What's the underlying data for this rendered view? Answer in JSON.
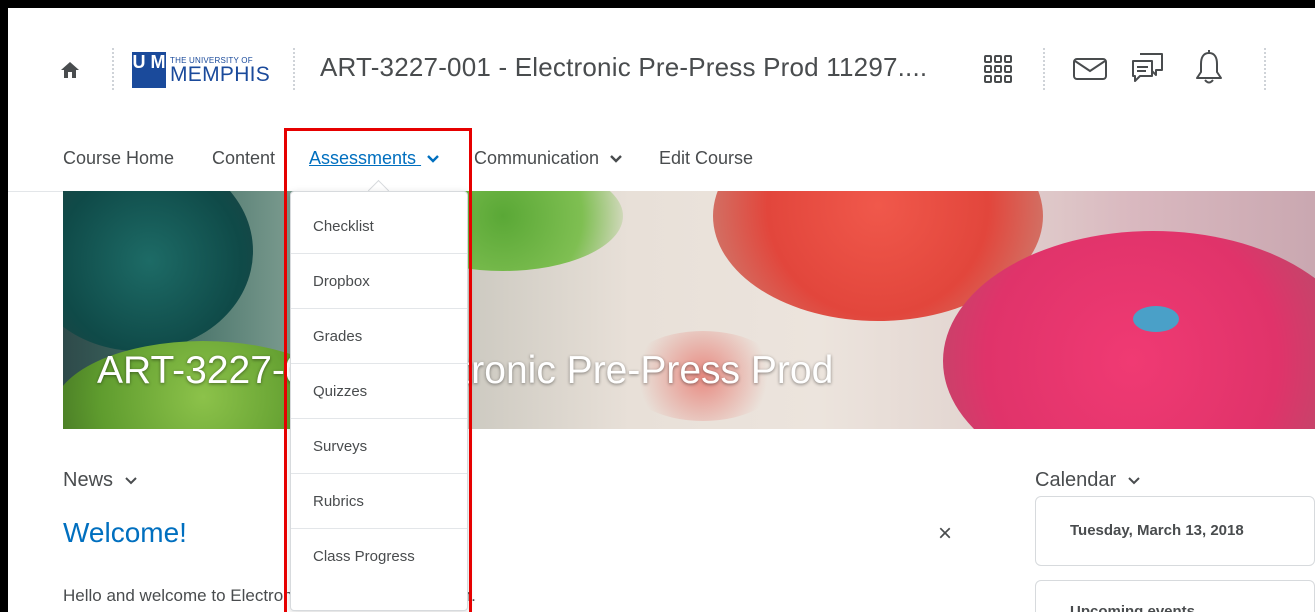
{
  "header": {
    "logo_small": "THE UNIVERSITY OF",
    "logo_big": "MEMPHIS",
    "logo_mark": "U M",
    "course_title": "ART-3227-001 - Electronic Pre-Press Prod 11297...."
  },
  "nav": {
    "items": [
      {
        "label": "Course Home"
      },
      {
        "label": "Content"
      },
      {
        "label": "Assessments"
      },
      {
        "label": "Communication"
      },
      {
        "label": "Edit Course"
      }
    ]
  },
  "banner": {
    "title": "ART-3227-001 - Electronic Pre-Press Prod"
  },
  "dropdown": {
    "items": [
      {
        "label": "Checklist"
      },
      {
        "label": "Dropbox"
      },
      {
        "label": "Grades"
      },
      {
        "label": "Quizzes"
      },
      {
        "label": "Surveys"
      },
      {
        "label": "Rubrics"
      },
      {
        "label": "Class Progress"
      }
    ]
  },
  "news": {
    "label": "News",
    "title": "Welcome!",
    "close": "×",
    "body": "Hello and welcome to Electronic Pre-Press Production."
  },
  "calendar": {
    "label": "Calendar",
    "date": "Tuesday, March 13, 2018",
    "upcoming": "Upcoming events"
  },
  "colors": {
    "link_blue": "#006fbf",
    "text_gray": "#494c4e",
    "highlight_red": "#e60000",
    "brand_blue": "#1a4a9b"
  },
  "icons": [
    "home-icon",
    "waffle-icon",
    "mail-icon",
    "chat-icon",
    "bell-icon",
    "chevron-down-icon",
    "close-icon"
  ]
}
